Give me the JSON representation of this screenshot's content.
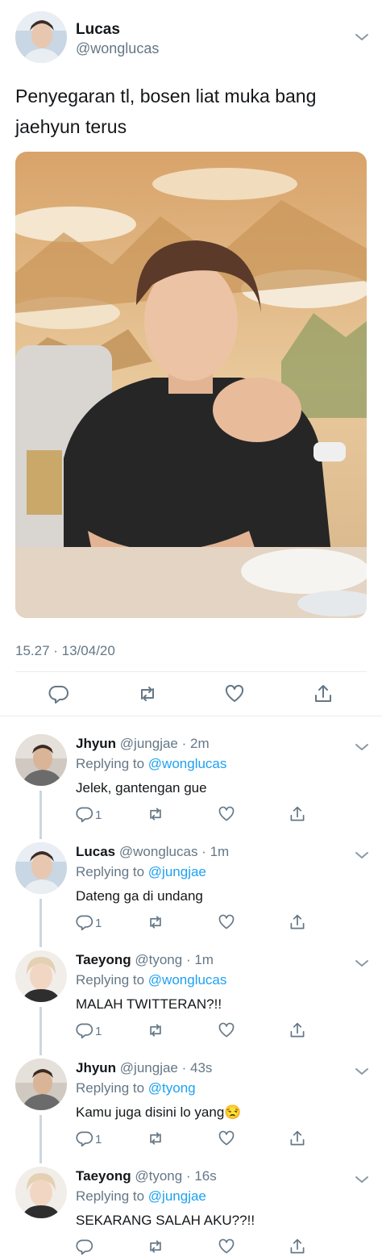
{
  "main_tweet": {
    "name": "Lucas",
    "handle": "@wonglucas",
    "text": "Penyegaran tl, bosen liat muka bang jaehyun terus",
    "timestamp": "15.27 · 13/04/20",
    "avatar_icon": "profile-photo",
    "media": "photo"
  },
  "actions": [
    "reply-icon",
    "retweet-icon",
    "like-icon",
    "share-icon"
  ],
  "colors": {
    "link": "#1da1f2",
    "muted": "#657786",
    "text": "#14171a",
    "divider": "#e6ecf0"
  },
  "replies": [
    {
      "name": "Jhyun",
      "meta": "@jungjae · 2m",
      "replying_prefix": "Replying to",
      "replying_to": "@wonglucas",
      "text": "Jelek, gantengan gue",
      "reply_count": "1"
    },
    {
      "name": "Lucas",
      "meta": "@wonglucas · 1m",
      "replying_prefix": "Replying to",
      "replying_to": "@jungjae",
      "text": "Dateng ga di undang",
      "reply_count": "1"
    },
    {
      "name": "Taeyong",
      "meta": "@tyong · 1m",
      "replying_prefix": "Replying to",
      "replying_to": "@wonglucas",
      "text": "MALAH TWITTERAN?!!",
      "reply_count": "1"
    },
    {
      "name": "Jhyun",
      "meta": "@jungjae · 43s",
      "replying_prefix": "Replying to",
      "replying_to": "@tyong",
      "text": "Kamu juga disini lo yang😒",
      "reply_count": "1"
    },
    {
      "name": "Taeyong",
      "meta": "@tyong · 16s",
      "replying_prefix": "Replying to",
      "replying_to": "@jungjae",
      "text": "SEKARANG SALAH AKU??!!",
      "reply_count": ""
    }
  ]
}
